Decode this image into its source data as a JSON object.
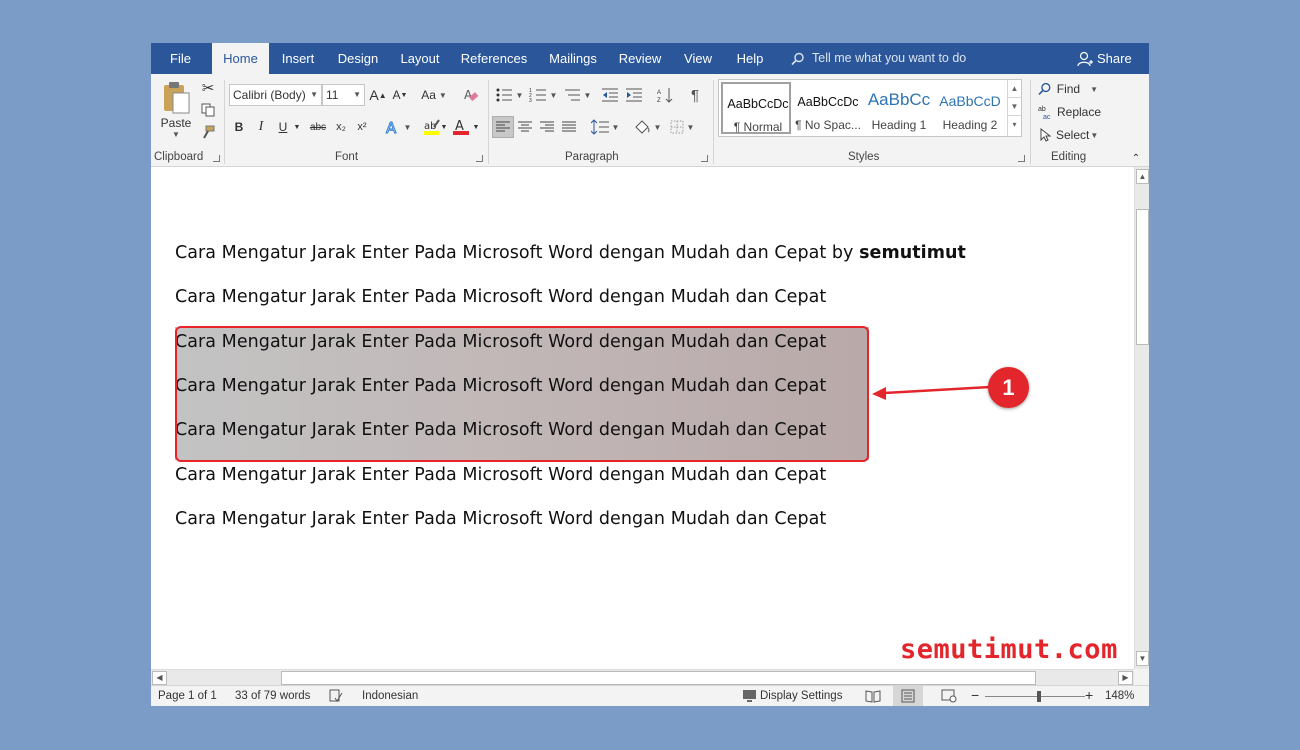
{
  "tabs": [
    "File",
    "Home",
    "Insert",
    "Design",
    "Layout",
    "References",
    "Mailings",
    "Review",
    "View",
    "Help"
  ],
  "active_tab": "Home",
  "tell_me": "Tell me what you want to do",
  "share": "Share",
  "clipboard": {
    "paste": "Paste",
    "label": "Clipboard"
  },
  "font": {
    "name": "Calibri (Body)",
    "size": "11",
    "change_case": "Aa",
    "label": "Font",
    "bold": "B",
    "italic": "I",
    "underline": "U",
    "strike": "abc",
    "subscript": "x₂",
    "superscript": "x²"
  },
  "paragraph": {
    "label": "Paragraph",
    "pilcrow": "¶"
  },
  "styles": {
    "label": "Styles",
    "items": [
      {
        "preview": "AaBbCcDc",
        "name": "¶ Normal"
      },
      {
        "preview": "AaBbCcDc",
        "name": "¶ No Spac..."
      },
      {
        "preview": "AaBbCc",
        "name": "Heading 1"
      },
      {
        "preview": "AaBbCcD",
        "name": "Heading 2"
      }
    ]
  },
  "editing": {
    "find": "Find",
    "replace": "Replace",
    "select": "Select",
    "label": "Editing"
  },
  "document": {
    "first_line": "Cara Mengatur Jarak Enter Pada Microsoft Word dengan Mudah dan Cepat by ",
    "first_line_bold": "semutimut",
    "lines": [
      "Cara Mengatur Jarak Enter Pada Microsoft Word dengan Mudah dan Cepat",
      "Cara Mengatur Jarak Enter Pada Microsoft Word dengan Mudah dan Cepat",
      "Cara Mengatur Jarak Enter Pada Microsoft Word dengan Mudah dan Cepat",
      "Cara Mengatur Jarak Enter Pada Microsoft Word dengan Mudah dan Cepat",
      "Cara Mengatur Jarak Enter Pada Microsoft Word dengan Mudah dan Cepat",
      "Cara Mengatur Jarak Enter Pada Microsoft Word dengan Mudah dan Cepat"
    ]
  },
  "status": {
    "page": "Page 1 of 1",
    "words": "33 of 79 words",
    "language": "Indonesian",
    "display": "Display Settings",
    "zoom": "148%",
    "zoom_minus": "−",
    "zoom_plus": "+"
  },
  "annotation": {
    "badge": "1",
    "color": "#e3262b"
  },
  "watermark": "semutimut.com",
  "colors": {
    "accent": "#2b579a",
    "highlight": "#ffff00",
    "font_color": "#e3262b"
  }
}
